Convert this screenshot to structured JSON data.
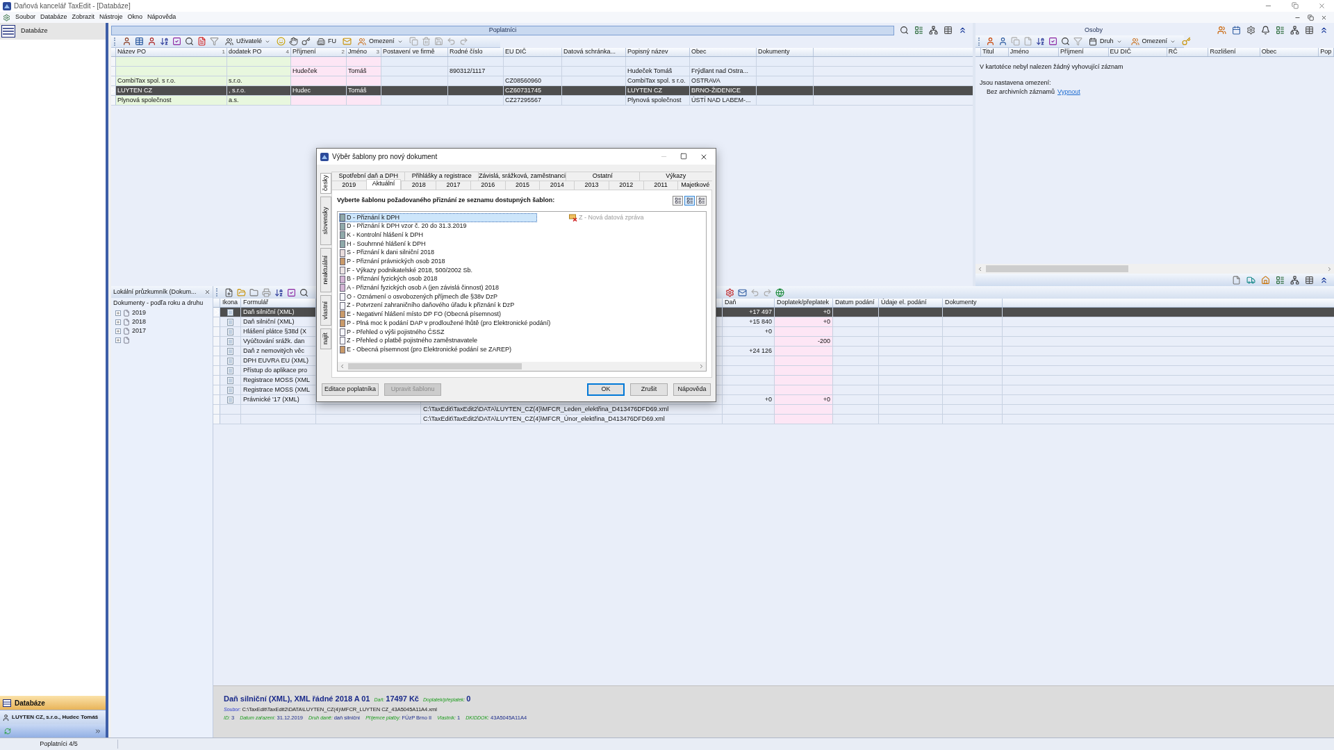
{
  "window": {
    "title": "Daňová kancelář TaxEdit - [Databáze]"
  },
  "menu": [
    "Soubor",
    "Databáze",
    "Zobrazit",
    "Nástroje",
    "Okno",
    "Nápověda"
  ],
  "sidebar": {
    "items": [
      {
        "label": "Databáze",
        "selected": true
      }
    ],
    "section": "Databáze",
    "taxpayer": "LUYTEN CZ, s.r.o., Hudec Tomáš"
  },
  "taxpayers": {
    "title": "Poplatníci",
    "toolbar": [
      {
        "label": "Uživatelé",
        "menu": true
      },
      {
        "label": "FU",
        "menu": false
      },
      {
        "label": "Omezení",
        "menu": true
      }
    ],
    "columns": [
      {
        "label": "Název PO",
        "sort": "1",
        "kind": "company"
      },
      {
        "label": "dodatek PO",
        "sort": "4",
        "kind": "company"
      },
      {
        "label": "Příjmení",
        "sort": "2",
        "kind": "person"
      },
      {
        "label": "Jméno",
        "sort": "3",
        "kind": "person"
      },
      {
        "label": "Postavení ve firmě",
        "kind": "other"
      },
      {
        "label": "Rodné číslo",
        "kind": "other"
      },
      {
        "label": "EU DIČ",
        "kind": "other"
      },
      {
        "label": "Datová schránka...",
        "kind": "other"
      },
      {
        "label": "Popisný název",
        "kind": "other"
      },
      {
        "label": "Obec",
        "kind": "other"
      },
      {
        "label": "Dokumenty",
        "kind": "other"
      }
    ],
    "rows": [
      {
        "selected": false,
        "cells": [
          null,
          null,
          null,
          null,
          null,
          null,
          null,
          null,
          null,
          null,
          null
        ]
      },
      {
        "selected": false,
        "cells": [
          null,
          null,
          "Hudeček",
          "Tomáš",
          null,
          "890312/1117",
          null,
          null,
          "Hudeček Tomáš",
          "Frýdlant nad Ostra...",
          null
        ]
      },
      {
        "selected": false,
        "cells": [
          "CombiTax spol. s r.o.",
          "s.r.o.",
          null,
          null,
          null,
          null,
          "CZ08560960",
          null,
          "CombiTax spol. s r.o.",
          "OSTRAVA",
          null
        ]
      },
      {
        "selected": true,
        "cells": [
          "LUYTEN CZ",
          ", s.r.o.",
          "Hudec",
          "Tomáš",
          null,
          null,
          "CZ60731745",
          null,
          "LUYTEN CZ",
          "BRNO-ŽIDENICE",
          null
        ]
      },
      {
        "selected": false,
        "cells": [
          "Plynová společnost",
          "a.s.",
          null,
          null,
          null,
          null,
          "CZ27295567",
          null,
          "Plynová společnost",
          "ÚSTÍ NAD LABEM-...",
          null
        ]
      }
    ]
  },
  "persons": {
    "title": "Osoby",
    "toolbar": [
      {
        "label": "Druh",
        "menu": true
      },
      {
        "label": "Omezení",
        "menu": true
      }
    ],
    "columns": [
      "Titul",
      "Jméno",
      "Příjmení",
      "EU DIČ",
      "RČ",
      "Rozlišení",
      "Obec",
      "Pop"
    ],
    "message": "V kartotéce nebyl nalezen žádný vyhovující záznam",
    "restrictions_title": "Jsou nastavena omezení:",
    "restriction": "Bez archivních záznamů",
    "restriction_link": "Vypnout"
  },
  "explorer": {
    "title": "Lokální průzkumník (Dokum...",
    "subtitle": "Dokumenty - podľa roku a druhu",
    "tree": [
      {
        "label": "2019",
        "expanded": false
      },
      {
        "label": "2018",
        "expanded": false
      },
      {
        "label": "2017",
        "expanded": false
      },
      {
        "expanded": false
      }
    ]
  },
  "documents": {
    "columns": [
      "Ikona",
      "Formulář",
      "Daň",
      "Doplatek/přeplatek",
      "Datum podání",
      "Údaje el. podání",
      "Dokumenty"
    ],
    "rows": [
      {
        "selected": true,
        "icon": true,
        "form": "Daň silniční (XML)",
        "tax": "+17 497",
        "balance": "+0"
      },
      {
        "selected": false,
        "icon": true,
        "form": "Daň silniční (XML)",
        "tax": "+15 840",
        "balance": "+0"
      },
      {
        "selected": false,
        "icon": true,
        "form": "Hlášení plátce §38d (X",
        "tax": "+0"
      },
      {
        "selected": false,
        "icon": true,
        "form": "Vyúčtování srážk. dan",
        "balance": "-200"
      },
      {
        "selected": false,
        "icon": true,
        "form": "Daň z nemovitých věc",
        "tax": "+24 126"
      },
      {
        "selected": false,
        "icon": true,
        "form": "DPH EUVRA EU (XML)"
      },
      {
        "selected": false,
        "icon": true,
        "form": "Přístup do aplikace pro"
      },
      {
        "selected": false,
        "icon": true,
        "form": "Registrace MOSS (XML"
      },
      {
        "selected": false,
        "icon": true,
        "form": "Registrace MOSS (XML"
      },
      {
        "selected": false,
        "icon": true,
        "form": "Právnické '17 (XML)",
        "tax": "+0",
        "balance": "+0"
      },
      {
        "selected": false,
        "icon": false,
        "column_4": "C:\\TaxEdit\\TaxEdit2\\DATA\\LUYTEN_CZ(4)\\MFCR_Leden_elektřina_D413476DFD69.xml"
      },
      {
        "selected": false,
        "icon": false,
        "column_4": "C:\\TaxEdit\\TaxEdit2\\DATA\\LUYTEN_CZ(4)\\MFCR_Únor_elektřina_D413476DFD69.xml"
      }
    ]
  },
  "document_info": {
    "title": "Daň silniční (XML), XML řádné 2018 A 01",
    "summary": [
      {
        "label": "Daň:",
        "value": "17497 Kč"
      },
      {
        "label": "Doplatek/přeplatek:",
        "value": "0"
      }
    ],
    "file": {
      "label": "Soubor:",
      "value": "C:\\TaxEdit\\TaxEdit2\\DATA\\LUYTEN_CZ(4)\\MFCR_LUYTEN CZ_43A5045A11A4.xml"
    },
    "details": [
      {
        "label": "ID:",
        "value": "3"
      },
      {
        "label": "Datum zařazení:",
        "value": "31.12.2019"
      },
      {
        "label": "Druh daně:",
        "value": "daň silniční"
      },
      {
        "label": "Příjemce platby:",
        "value": "FÚzP Brno II"
      },
      {
        "label": "Vlastník:",
        "value": "1"
      },
      {
        "label": "DKIDDOK:",
        "value": "43A5045A11A4"
      }
    ]
  },
  "dialog": {
    "title": "Výběr šablony pro nový dokument",
    "side_tabs": [
      {
        "label": "česky",
        "selected": true
      },
      {
        "label": "slovensky",
        "selected": false
      },
      {
        "label": "neaktuální",
        "selected": false
      },
      {
        "label": "vlastní",
        "selected": false
      },
      {
        "label": "najít",
        "selected": false
      }
    ],
    "tabs_row_1": [
      {
        "label": "Spotřební daň a DPH",
        "selected": false
      },
      {
        "label": "Přihlášky a registrace",
        "selected": false
      },
      {
        "label": "Závislá, srážková, zaměstnanci",
        "selected": false
      },
      {
        "label": "Ostatní",
        "selected": false
      },
      {
        "label": "Výkazy",
        "selected": false
      }
    ],
    "tabs_row_2": [
      {
        "label": "2019",
        "selected": false
      },
      {
        "label": "Aktuální",
        "selected": true
      },
      {
        "label": "2018",
        "selected": false
      },
      {
        "label": "2017",
        "selected": false
      },
      {
        "label": "2016",
        "selected": false
      },
      {
        "label": "2015",
        "selected": false
      },
      {
        "label": "2014",
        "selected": false
      },
      {
        "label": "2013",
        "selected": false
      },
      {
        "label": "2012",
        "selected": false
      },
      {
        "label": "2011",
        "selected": false
      },
      {
        "label": "Majetkové",
        "selected": false
      }
    ],
    "instruction": "Vyberte šablonu požadovaného přiznání ze seznamu dostupných šablon:",
    "view_buttons": [
      {
        "selected": false
      },
      {
        "selected": true
      },
      {
        "selected": false
      }
    ],
    "templates": [
      {
        "label": "D - Přiznání k DPH",
        "color": "#8fa9a9",
        "selected": true
      },
      {
        "label": "D - Přiznání k DPH vzor č. 20 do 31.3.2019",
        "color": "#8fa9a9",
        "selected": false
      },
      {
        "label": "K - Kontrolní hlášení k DPH",
        "color": "#8fa9a9",
        "selected": false
      },
      {
        "label": "H - Souhrnné hlášení k DPH",
        "color": "#8fa9a9",
        "selected": false
      },
      {
        "label": "S - Přiznání k dani silniční 2018",
        "color": "#e8dcdc",
        "selected": false
      },
      {
        "label": "P - Přiznání právnických osob 2018",
        "color": "#c89a6a",
        "selected": false
      },
      {
        "label": "F - Výkazy podnikatelské 2018, 500/2002 Sb.",
        "color": "#ece4e4",
        "selected": false
      },
      {
        "label": "B - Přiznání fyzických osob 2018",
        "color": "#d4b4d4",
        "selected": false
      },
      {
        "label": "A - Přiznání fyzických osob A (jen závislá činnost) 2018",
        "color": "#d4b4d4",
        "selected": false
      },
      {
        "label": "O - Oznámení o osvobozených příjmech dle §38v DzP",
        "color": "#f6f6fa",
        "selected": false
      },
      {
        "label": "Z - Potvrzení zahraničního daňového úřadu k přiznání k DzP",
        "color": "#f6f6fa",
        "selected": false
      },
      {
        "label": "E - Negativní hlášení místo DP FO (Obecná písemnost)",
        "color": "#c89a6a",
        "selected": false
      },
      {
        "label": "P - Plná moc k podání DAP v prodloužené lhůtě (pro Elektronické podání)",
        "color": "#c89a6a",
        "selected": false
      },
      {
        "label": "P - Přehled o výši pojistného ČSSZ",
        "color": "#f6f6fa",
        "selected": false
      },
      {
        "label": "Z - Přehled o platbě pojistného zaměstnavatele",
        "color": "#f6f6fa",
        "selected": false
      },
      {
        "label": "E - Obecná písemnost (pro Elektronické podání se ZAREP)",
        "color": "#c89a6a",
        "selected": false
      }
    ],
    "templates_column_2": [
      {
        "label": "Z - Nová datová zpráva",
        "disabled": true
      }
    ],
    "buttons": [
      {
        "label": "Editace poplatníka",
        "disabled": false,
        "default": false
      },
      {
        "label": "Upravit šablonu",
        "disabled": true,
        "default": false
      },
      {
        "label": "OK",
        "disabled": false,
        "default": true
      },
      {
        "label": "Zrušit",
        "disabled": false,
        "default": false
      },
      {
        "label": "Nápověda",
        "disabled": false,
        "default": false
      }
    ]
  },
  "status_bar": [
    "Poplatníci 4/5"
  ]
}
